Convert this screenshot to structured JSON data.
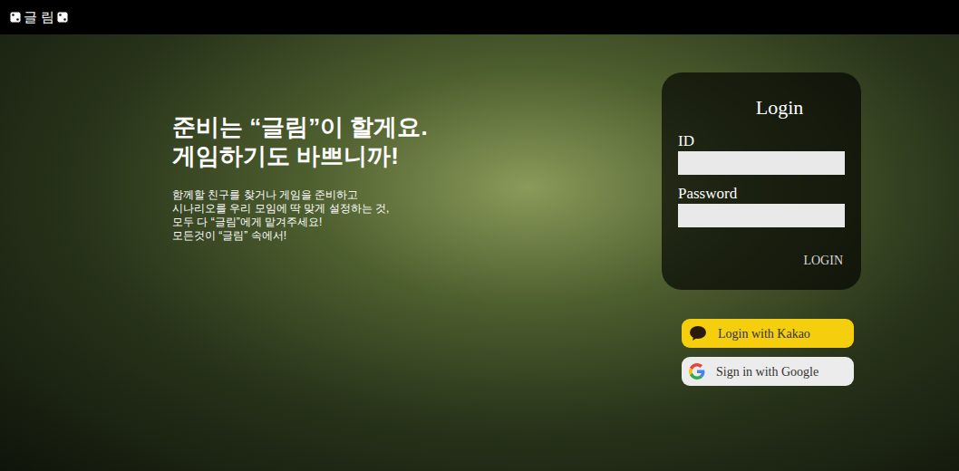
{
  "window": {
    "logo": "글 림"
  },
  "hero": {
    "headline": [
      "준비는 “글림”이 할게요.",
      "게임하기도 바쁘니까!"
    ],
    "description": [
      "함께할 친구를 찾거나 게임을 준비하고",
      "시나리오를 우리 모임에 딱 맞게 설정하는 것,",
      "모두 다 “글림”에게 맡겨주세요!",
      "모든것이 “글림” 속에서!"
    ]
  },
  "login": {
    "title": "Login",
    "fields": [
      {
        "label": "ID",
        "value": ""
      },
      {
        "label": "Password",
        "value": ""
      }
    ],
    "submit": "LOGIN"
  },
  "social_buttons": [
    {
      "kind": "kakao",
      "label": "Login with Kakao",
      "color": "#f5cf0e"
    },
    {
      "kind": "google",
      "label": "Sign in with Google",
      "color": "#ececec"
    }
  ]
}
